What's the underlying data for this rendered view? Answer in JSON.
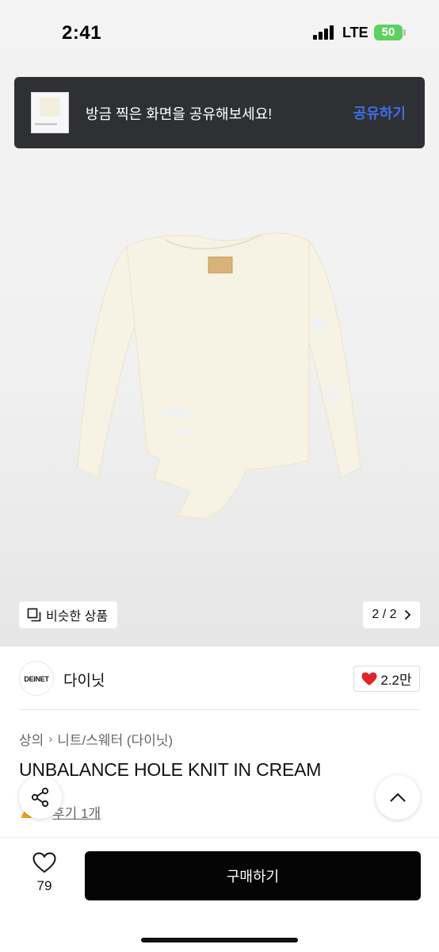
{
  "status_bar": {
    "time": "2:41",
    "network": "LTE",
    "battery": "50"
  },
  "share_banner": {
    "message": "방금 찍은 화면을 공유해보세요!",
    "action_label": "공유하기"
  },
  "gallery": {
    "similar_label": "비슷한 상품",
    "page_indicator": "2 / 2"
  },
  "seller": {
    "logo_text": "DEINET",
    "name": "다이닛",
    "likes": "2.2만"
  },
  "product": {
    "breadcrumb": [
      "상의",
      "니트/스웨터 (다이닛)"
    ],
    "title": "UNBALANCE HOLE KNIT IN CREAM",
    "review_label": "후기 1개"
  },
  "bottom_bar": {
    "wish_count": "79",
    "buy_label": "구매하기"
  },
  "colors": {
    "accent_blue": "#3d6fe8",
    "heart_red": "#e0252b",
    "banner_bg": "#2f3034",
    "buy_button": "#050505",
    "battery_green": "#5fcf5f",
    "garment_cream": "#f6f3e4"
  }
}
